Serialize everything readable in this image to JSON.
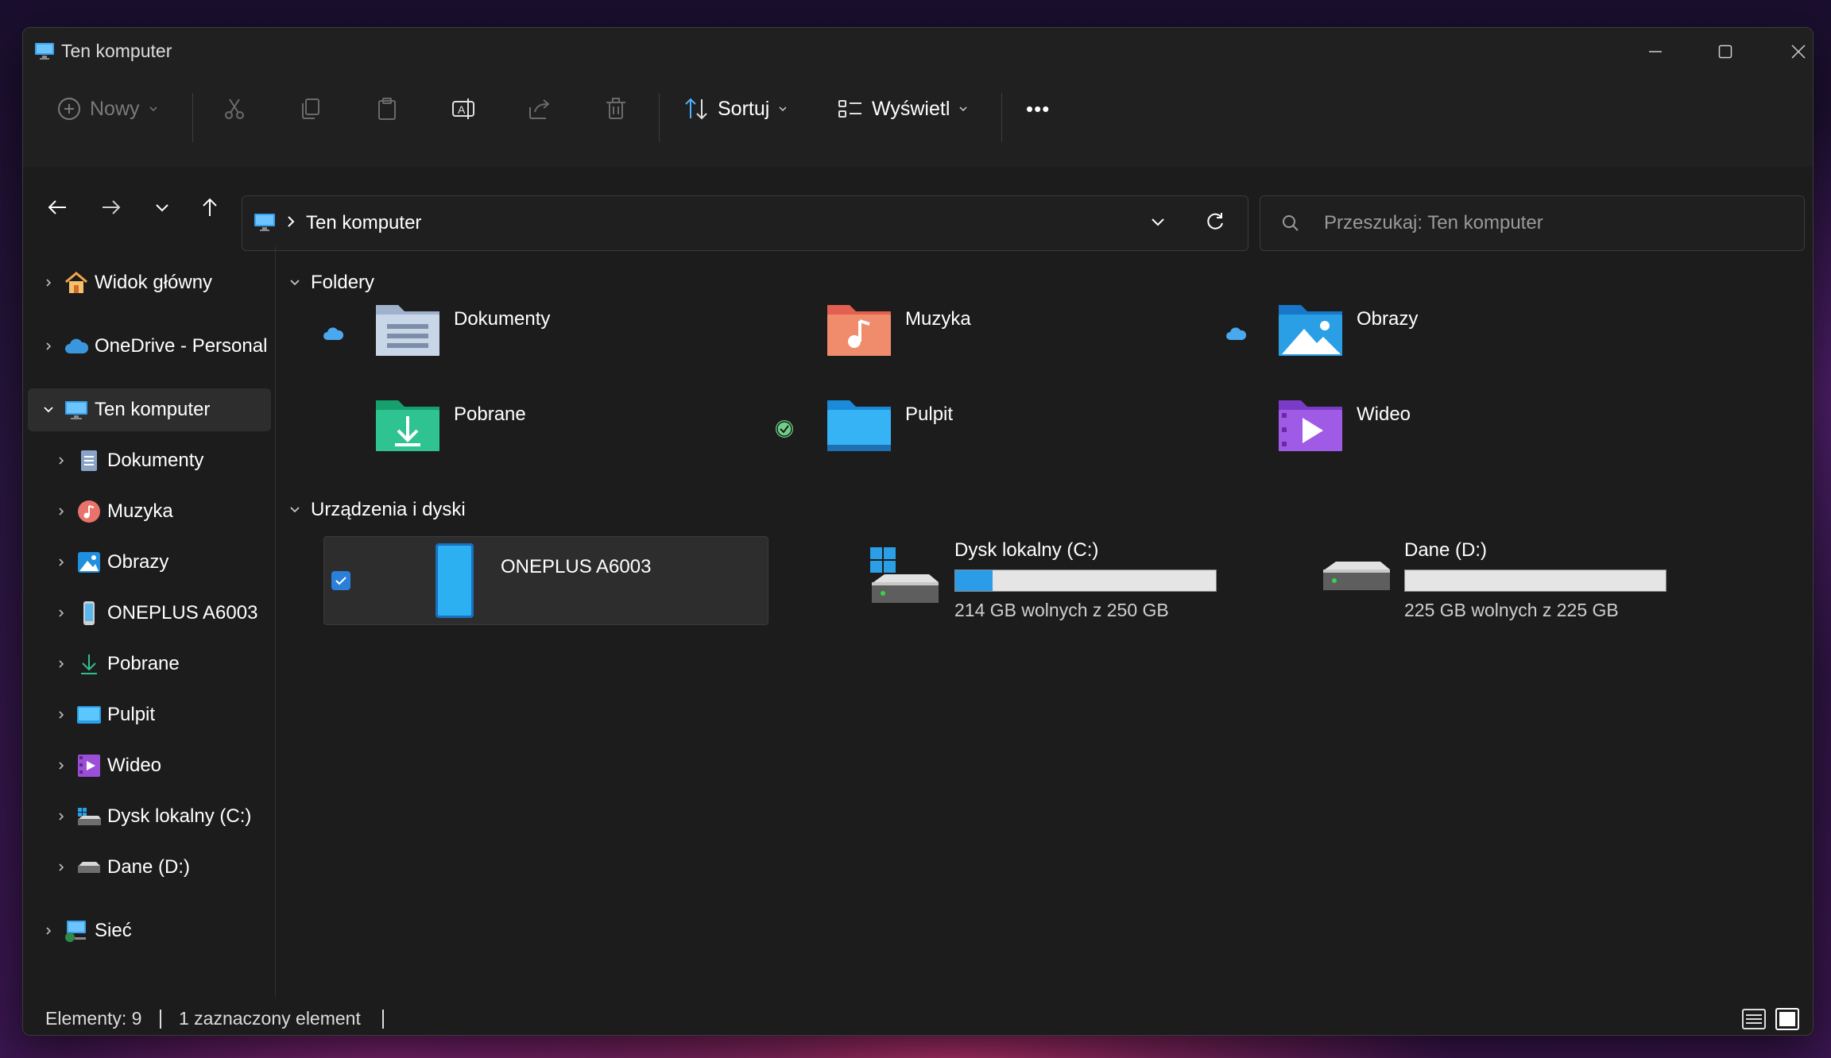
{
  "window": {
    "title": "Ten komputer"
  },
  "toolbar": {
    "new_label": "Nowy",
    "sort_label": "Sortuj",
    "view_label": "Wyświetl",
    "more_label": "•••"
  },
  "address": {
    "path": "Ten komputer",
    "search_placeholder": "Przeszukaj: Ten komputer"
  },
  "sidebar": {
    "items": [
      {
        "label": "Widok główny"
      },
      {
        "label": "OneDrive - Personal"
      },
      {
        "label": "Ten komputer"
      },
      {
        "label": "Dokumenty"
      },
      {
        "label": "Muzyka"
      },
      {
        "label": "Obrazy"
      },
      {
        "label": "ONEPLUS A6003"
      },
      {
        "label": "Pobrane"
      },
      {
        "label": "Pulpit"
      },
      {
        "label": "Wideo"
      },
      {
        "label": "Dysk lokalny (C:)"
      },
      {
        "label": "Dane (D:)"
      },
      {
        "label": "Sieć"
      }
    ]
  },
  "main": {
    "folders_header": "Foldery",
    "folders": [
      {
        "name": "Dokumenty",
        "status": "cloud"
      },
      {
        "name": "Muzyka",
        "status": ""
      },
      {
        "name": "Obrazy",
        "status": "cloud"
      },
      {
        "name": "Pobrane",
        "status": ""
      },
      {
        "name": "Pulpit",
        "status": "synced"
      },
      {
        "name": "Wideo",
        "status": ""
      }
    ],
    "devices_header": "Urządzenia i dyski",
    "devices": [
      {
        "name": "ONEPLUS A6003",
        "selected": true
      },
      {
        "name": "Dysk lokalny (C:)",
        "free": "214 GB wolnych z 250 GB",
        "used_fraction": 0.144
      },
      {
        "name": "Dane (D:)",
        "free": "225 GB wolnych z 225 GB",
        "used_fraction": 0.0
      }
    ]
  },
  "status": {
    "items": "Elementy: 9",
    "selected": "1 zaznaczony element"
  },
  "colors": {
    "accent": "#2b9de8",
    "window_bg": "#1c1c1c",
    "toolbar_bg": "#202020",
    "selected_bg": "#2d2d2d"
  }
}
